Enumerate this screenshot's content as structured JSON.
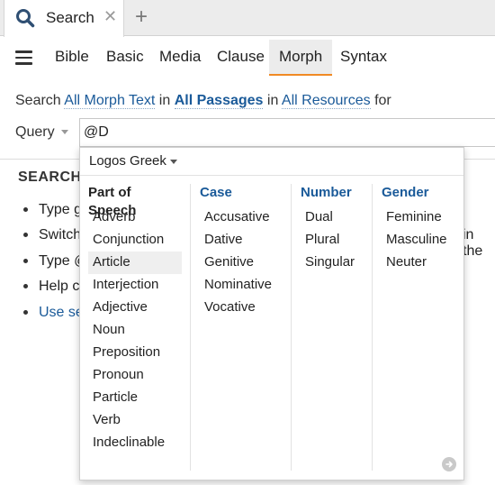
{
  "tab": {
    "title": "Search",
    "close_glyph": "✕",
    "new_glyph": "+",
    "icon": "search-icon"
  },
  "nav": {
    "tabs": [
      "Bible",
      "Basic",
      "Media",
      "Clause",
      "Morph",
      "Syntax"
    ],
    "active": "Morph"
  },
  "search_line": {
    "prefix": "Search",
    "text_link": "All Morph Text",
    "in1": "in",
    "passages_link": "All Passages",
    "in2": "in",
    "resources_link": "All Resources",
    "suffix": "for"
  },
  "query": {
    "label": "Query",
    "value": "@D"
  },
  "help": {
    "heading": "SEARCH",
    "items": [
      "Type g",
      "Switch",
      "Type @",
      "Help c",
      "Use se"
    ],
    "right_fragment": "in the"
  },
  "dropdown": {
    "language": "Logos Greek",
    "columns": [
      {
        "header": "Part of Speech",
        "items": [
          "Adverb",
          "Conjunction",
          "Article",
          "Interjection",
          "Adjective",
          "Noun",
          "Preposition",
          "Pronoun",
          "Particle",
          "Verb",
          "Indeclinable"
        ],
        "highlighted": "Article"
      },
      {
        "header": "Case",
        "items": [
          "Accusative",
          "Dative",
          "Genitive",
          "Nominative",
          "Vocative"
        ]
      },
      {
        "header": "Number",
        "items": [
          "Dual",
          "Plural",
          "Singular"
        ]
      },
      {
        "header": "Gender",
        "items": [
          "Feminine",
          "Masculine",
          "Neuter"
        ]
      }
    ]
  },
  "colors": {
    "accent": "#f08a24",
    "link": "#1a5a99"
  }
}
